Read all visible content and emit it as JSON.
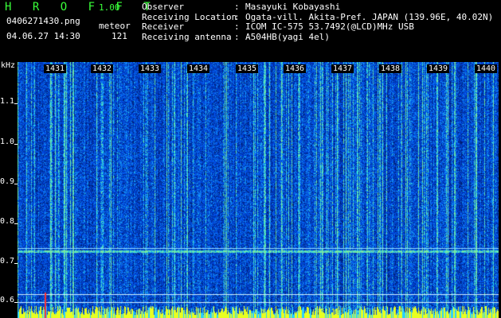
{
  "header": {
    "app_title": "H R O F F T",
    "version": "1.00",
    "filename": "0406271430.png",
    "datetime": "04.06.27 14:30",
    "mode_label": "meteor",
    "count": "121",
    "fields": [
      {
        "key": "Observer",
        "value": "Masayuki Kobayashi"
      },
      {
        "key": "Receiving Location",
        "value": "Ogata-vill. Akita-Pref. JAPAN (139.96E, 40.02N)"
      },
      {
        "key": "Receiver",
        "value": "ICOM IC-575 53.7492(@LCD)MHz USB"
      },
      {
        "key": "Receiving antenna",
        "value": "A504HB(yagi 4el)"
      }
    ]
  },
  "axis": {
    "unit": "kHz",
    "y_ticks": [
      "1.1",
      "1.0",
      "0.9",
      "0.8",
      "0.7",
      "0.6"
    ],
    "x_ticks": [
      "1431",
      "1432",
      "1433",
      "1434",
      "1435",
      "1436",
      "1437",
      "1438",
      "1439",
      "1440"
    ]
  },
  "colors": {
    "background": "#000000",
    "noise_low": "#001a5c",
    "noise_high": "#2a66ff",
    "signal": "#36e0c8",
    "title_green": "#39ff39",
    "marker_yellow": "#e8ff20",
    "tick_red": "#ff3030"
  }
}
